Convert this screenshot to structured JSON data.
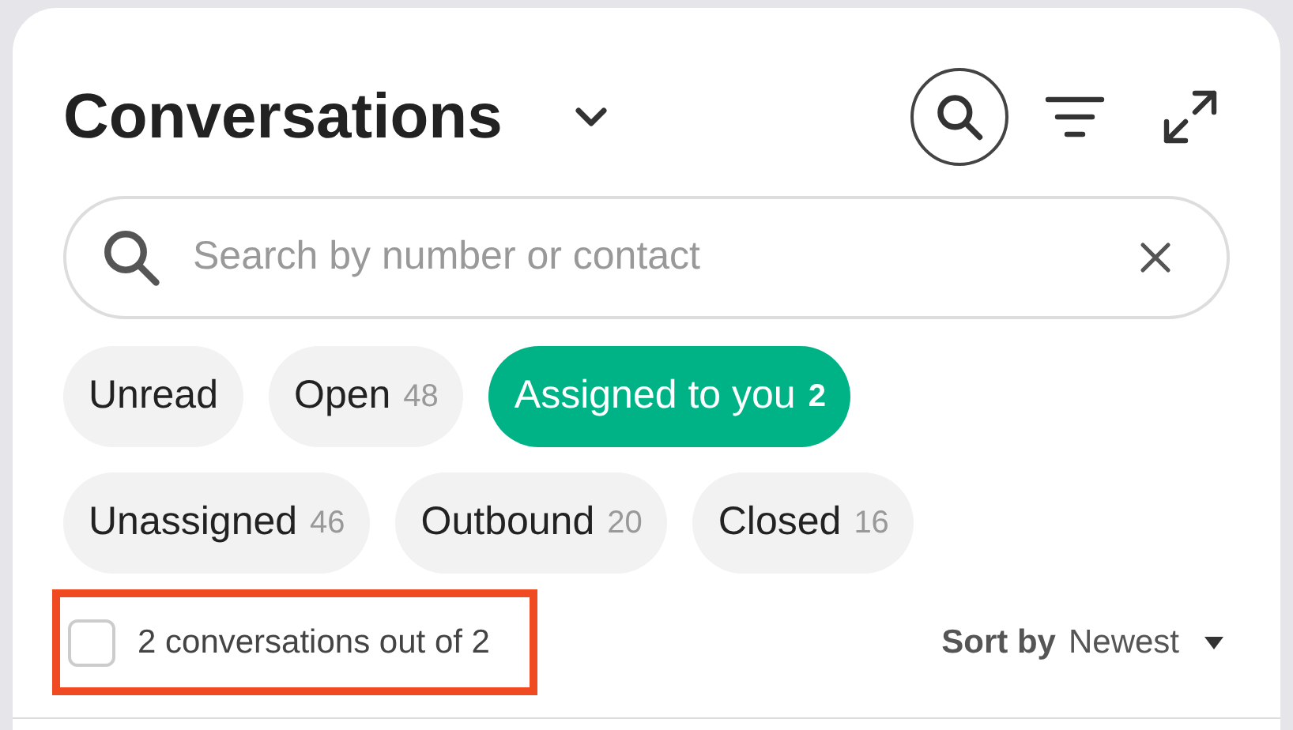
{
  "header": {
    "title": "Conversations"
  },
  "search": {
    "placeholder": "Search by number or contact"
  },
  "filter_chips": [
    {
      "label": "Unread",
      "selected": false
    },
    {
      "label": "Open",
      "count": "48",
      "selected": false
    },
    {
      "label": "Assigned to you",
      "count": "2",
      "selected": true
    },
    {
      "label": "Unassigned",
      "count": "46",
      "selected": false
    },
    {
      "label": "Outbound",
      "count": "20",
      "selected": false
    },
    {
      "label": "Closed",
      "count": "16",
      "selected": false
    }
  ],
  "list_header": {
    "select_all_checked": false,
    "summary": "2 conversations out of 2",
    "highlighted": true,
    "sort_label": "Sort by",
    "sort_value": "Newest"
  }
}
